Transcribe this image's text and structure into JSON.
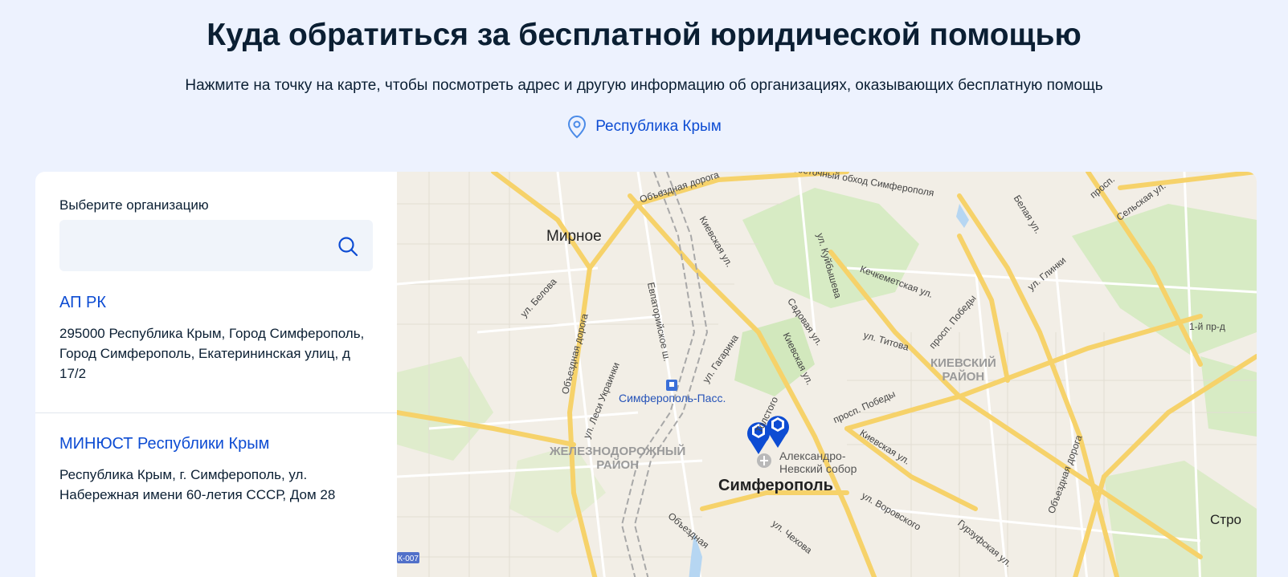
{
  "header": {
    "title": "Куда обратиться за бесплатной юридической помощью",
    "subtitle": "Нажмите на точку на карте, чтобы посмотреть адрес и другую информацию об организациях, оказывающих бесплатную помощь",
    "region": "Республика Крым"
  },
  "panel": {
    "label": "Выберите организацию",
    "search_placeholder": "",
    "search_value": "",
    "organizations": [
      {
        "name": "АП РК",
        "address": "295000 Республика Крым, Город Симферополь, Город Симферополь, Екатерининская улиц, д 17/2"
      },
      {
        "name": "МИНЮСТ Республики Крым",
        "address": "Республика Крым, г. Симферополь, ул. Набережная имени 60-летия СССР, Дом 28"
      }
    ]
  },
  "map": {
    "city": "Симферополь",
    "town": "Мирное",
    "districts": {
      "zheleznodorozhny": [
        "ЖЕЛЕЗНОДОРОЖНЫЙ",
        "РАЙОН"
      ],
      "kievsky": [
        "КИЕВСКИЙ",
        "РАЙОН"
      ]
    },
    "station": "Симферополь-Пасс.",
    "poi": [
      "Александро-",
      "Невский собор"
    ],
    "streets": {
      "obezdnaya_top": "Объездная дорога",
      "obhod": "Восточный обход Симферополя",
      "kievskaya1": "Киевская ул.",
      "kievskaya2": "Киевская ул.",
      "kievskaya3": "Киевская ул.",
      "kuibysheva": "ул. Куйбышева",
      "kechkemetskaya": "Кечкеметская ул.",
      "belaya": "Белая ул.",
      "selskaya": "Сельская ул.",
      "glinki": "ул. Глинки",
      "belova": "ул. Белова",
      "evpatoriyskoe": "Евпаторийское ш.",
      "obezdnaya_left": "Объездная дорога",
      "obezdnaya_right": "Объездная дорога",
      "sadovaya": "Садовая ул.",
      "titova": "ул. Титова",
      "pobedy1": "просп. Победы",
      "pobedy2": "просп. Победы",
      "gagarina": "ул. Гагарина",
      "ukrainki": "ул. Леси Украинки",
      "vorovskogo": "ул. Воровского",
      "chekhova": "ул. Чехова",
      "gurzufskaya": "Гурзуфская ул.",
      "pr1": "1-й пр-д",
      "prosp": "просп.",
      "obezdnaya_bottom": "Объездная",
      "road_code": "К-007",
      "stro": "Стро",
      "tolstogo": "Толстого"
    }
  },
  "colors": {
    "background": "#edf2fe",
    "link": "#0d4cd3",
    "text": "#0b1f33",
    "marker": "#0d4cd3"
  },
  "icons": {
    "region": "location-pin-icon",
    "search": "search-icon",
    "marker": "map-marker-icon"
  }
}
